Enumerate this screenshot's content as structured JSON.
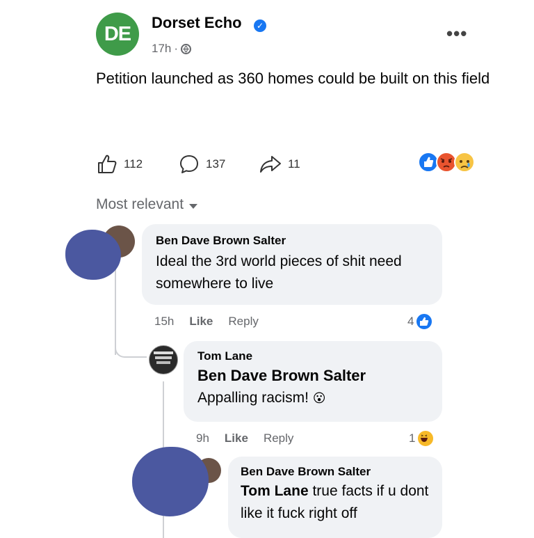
{
  "post": {
    "page_logo_text": "DE",
    "page_name": "Dorset Echo",
    "time": "17h",
    "separator": "·",
    "text": "Petition launched as 360 homes could be built on this field",
    "likes": "112",
    "comments": "137",
    "shares": "11",
    "reaction_icons": [
      "like-icon",
      "angry-icon",
      "sad-icon"
    ],
    "more_label": "•••"
  },
  "sort": {
    "label": "Most relevant"
  },
  "comments": [
    {
      "author": "Ben Dave Brown Salter",
      "text": "Ideal the 3rd world pieces of shit need somewhere to live",
      "time": "15h",
      "like": "Like",
      "reply": "Reply",
      "reaction_count": "4",
      "reaction_icon": "like-icon"
    },
    {
      "author": "Tom Lane",
      "tag": "Ben Dave Brown Salter",
      "text": "Appalling racism!",
      "emoji": "😮",
      "time": "9h",
      "like": "Like",
      "reply": "Reply",
      "reaction_count": "1",
      "reaction_icon": "haha-icon"
    },
    {
      "author": "Ben Dave Brown Salter",
      "tag": "Tom Lane",
      "text": "true facts if u dont like it fuck right off"
    }
  ],
  "colors": {
    "logo_green": "#3f9b49",
    "fb_blue": "#1877f2",
    "bubble_bg": "#f0f2f5",
    "redaction_blob": "#4b58a0"
  }
}
